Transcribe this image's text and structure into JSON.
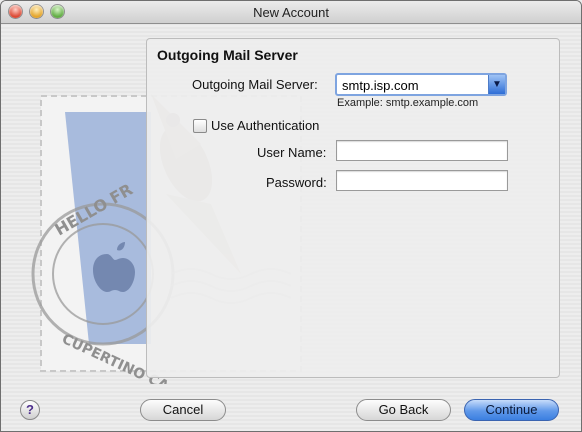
{
  "window": {
    "title": "New Account"
  },
  "section": {
    "title": "Outgoing Mail Server"
  },
  "form": {
    "server_label": "Outgoing Mail Server:",
    "server_value": "smtp.isp.com",
    "server_hint": "Example: smtp.example.com",
    "use_auth_label": "Use Authentication",
    "use_auth_checked": false,
    "user_name_label": "User Name:",
    "user_name_value": "",
    "password_label": "Password:",
    "password_value": ""
  },
  "buttons": {
    "help": "?",
    "cancel": "Cancel",
    "go_back": "Go Back",
    "continue": "Continue"
  },
  "stamp": {
    "text_top": "HELLO FR",
    "text_bottom": "CUPERTINO CA"
  },
  "colors": {
    "accent": "#3b7fe1",
    "focus_ring": "#7ea4e0",
    "stamp_blue": "#8fa8d6"
  }
}
